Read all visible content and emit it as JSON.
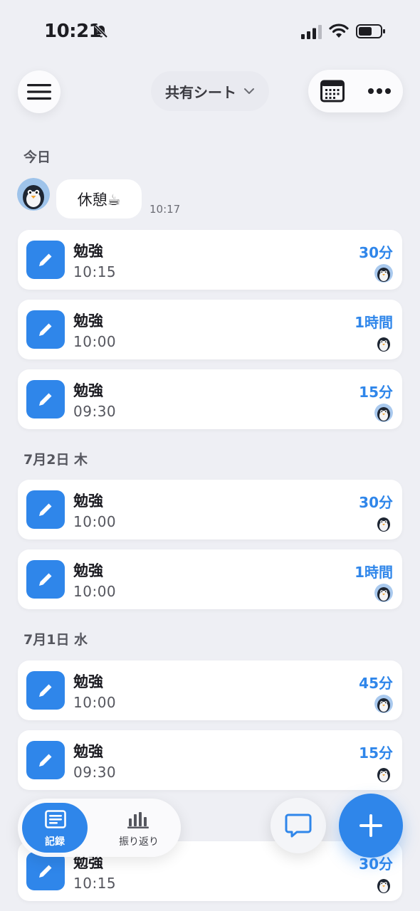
{
  "status_bar": {
    "time": "10:21",
    "icons": [
      "bell-slash-icon",
      "signal-icon",
      "wifi-icon",
      "battery-icon"
    ]
  },
  "header": {
    "menu_icon": "hamburger-icon",
    "sheet_title": "共有シート",
    "calendar_icon": "calendar-icon",
    "more_icon": "ellipsis-icon"
  },
  "sections": [
    {
      "label": "今日"
    },
    {
      "label": "7月2日 木"
    },
    {
      "label": "7月1日 水"
    }
  ],
  "message": {
    "text": "休憩☕",
    "time": "10:17"
  },
  "records": [
    {
      "title": "勉強",
      "time": "10:15",
      "duration": "30分"
    },
    {
      "title": "勉強",
      "time": "10:00",
      "duration": "1時間"
    },
    {
      "title": "勉強",
      "time": "09:30",
      "duration": "15分"
    },
    {
      "title": "勉強",
      "time": "10:00",
      "duration": "30分"
    },
    {
      "title": "勉強",
      "time": "10:00",
      "duration": "1時間"
    },
    {
      "title": "勉強",
      "time": "10:00",
      "duration": "45分"
    },
    {
      "title": "勉強",
      "time": "09:30",
      "duration": "15分"
    },
    {
      "title": "勉強",
      "time": "10:15",
      "duration": "30分"
    }
  ],
  "tab_bar": {
    "tabs": [
      {
        "label": "記録",
        "icon": "list-icon",
        "active": true
      },
      {
        "label": "振り返り",
        "icon": "bar-chart-icon",
        "active": false
      }
    ]
  },
  "fabs": {
    "chat_icon": "speech-bubble-icon",
    "add_icon": "plus-icon"
  },
  "colors": {
    "accent": "#2f86ea",
    "background": "#eeeff4",
    "card": "#ffffff"
  }
}
